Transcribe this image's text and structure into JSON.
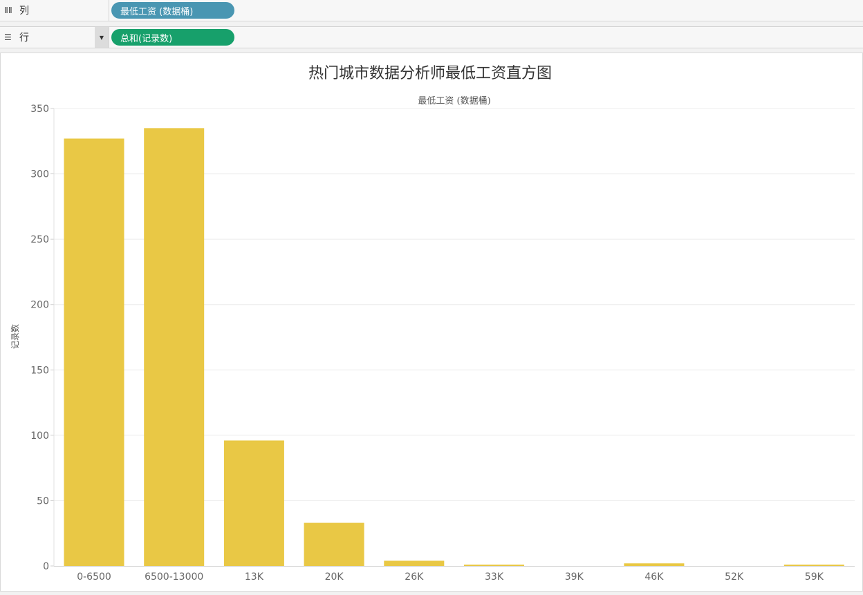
{
  "shelves": {
    "columns": {
      "icon": "columns-icon",
      "label": "列",
      "pill": "最低工资 (数据桶)"
    },
    "rows": {
      "icon": "rows-icon",
      "label": "行",
      "pill": "总和(记录数)"
    }
  },
  "colors": {
    "bar": "#e9c845",
    "pill_columns": "#4996b2",
    "pill_rows": "#17a06b"
  },
  "chart_data": {
    "type": "bar",
    "title": "热门城市数据分析师最低工资直方图",
    "column_header": "最低工资 (数据桶)",
    "xlabel": "",
    "ylabel": "记录数",
    "categories": [
      "0-6500",
      "6500-13000",
      "13K",
      "20K",
      "26K",
      "33K",
      "39K",
      "46K",
      "52K",
      "59K"
    ],
    "values": [
      327,
      335,
      96,
      33,
      4,
      1,
      0,
      2,
      0,
      1
    ],
    "ylim": [
      0,
      350
    ],
    "yticks": [
      0,
      50,
      100,
      150,
      200,
      250,
      300,
      350
    ],
    "grid": true,
    "legend": "none"
  }
}
